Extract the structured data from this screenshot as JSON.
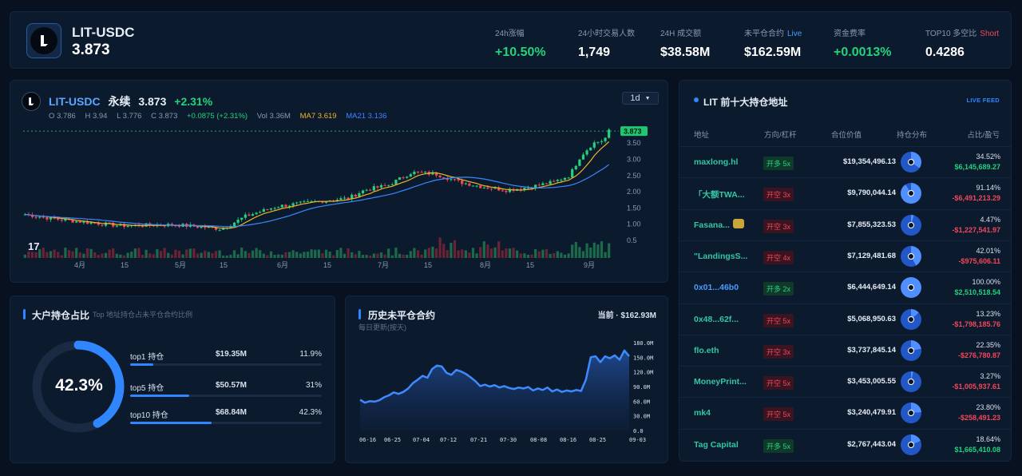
{
  "header": {
    "pair": "LIT-USDC",
    "price": "3.873",
    "stats": [
      {
        "label": "24h涨幅",
        "value": "+10.50%",
        "tone": "green",
        "tag": ""
      },
      {
        "label": "24小时交易人数",
        "value": "1,749",
        "tone": "white",
        "tag": ""
      },
      {
        "label": "24H 成交额",
        "value": "$38.58M",
        "tone": "white",
        "tag": ""
      },
      {
        "label": "未平仓合约",
        "value": "$162.59M",
        "tone": "white",
        "tag": "Live"
      },
      {
        "label": "资金费率",
        "value": "+0.0013%",
        "tone": "green",
        "tag": ""
      },
      {
        "label": "TOP10 多空比",
        "value": "0.4286",
        "tone": "white",
        "tag": "Short"
      }
    ]
  },
  "price_chart": {
    "pair": "LIT-USDC",
    "market": "永续",
    "last": "3.873",
    "change": "+2.31%",
    "interval": "1d",
    "ohlc": {
      "o": "O 3.786",
      "h": "H 3.94",
      "l": "L 3.776",
      "c": "C 3.873",
      "chg": "+0.0875 (+2.31%)",
      "vol": "Vol 3.36M"
    },
    "ma7": "MA7 3.619",
    "ma21": "MA21 3.136",
    "price_tag": "3.873",
    "y_ticks": [
      "3.50",
      "3.00",
      "2.50",
      "2.00",
      "1.50",
      "1.00",
      "0.5"
    ],
    "x_ticks": [
      "4月",
      "15",
      "5月",
      "15",
      "6月",
      "15",
      "7月",
      "15",
      "8月",
      "15",
      "9月"
    ],
    "colors": {
      "up": "#26d07c",
      "down": "#f2475a",
      "ma7": "#f0b429",
      "ma21": "#3a86ff"
    }
  },
  "chart_data": {
    "type": "line",
    "title": "历史未平仓合约",
    "subtitle": "每日更新(按天)",
    "current": "当前 · $162.93M",
    "x_ticks": [
      "06-16",
      "06-25",
      "07-04",
      "07-12",
      "07-21",
      "07-30",
      "08-08",
      "08-16",
      "08-25",
      "09-03"
    ],
    "y_ticks": [
      "180.0M",
      "150.0M",
      "120.0M",
      "90.0M",
      "60.0M",
      "30.0M",
      "0.0"
    ],
    "ylim": [
      0,
      180
    ],
    "series": [
      {
        "values": [
          63,
          57,
          60,
          59,
          62,
          68,
          72,
          78,
          75,
          79,
          86,
          97,
          104,
          112,
          108,
          126,
          133,
          131,
          118,
          114,
          124,
          121,
          116,
          109,
          101,
          91,
          94,
          90,
          93,
          88,
          91,
          87,
          85,
          88,
          86,
          89,
          82,
          86,
          83,
          88,
          80,
          84,
          79,
          82,
          80,
          83,
          81,
          104,
          150,
          152,
          140,
          152,
          148,
          154,
          145,
          164,
          152
        ]
      }
    ]
  },
  "concentration": {
    "title": "大户持仓占比",
    "subtitle": "Top 地址持仓占未平仓合约比例",
    "percent": "42.3%",
    "fraction": 0.423,
    "rows": [
      {
        "label": "top1 持仓",
        "value": "$19.35M",
        "pct": "11.9%",
        "fraction": 0.119
      },
      {
        "label": "top5 持仓",
        "value": "$50.57M",
        "pct": "31%",
        "fraction": 0.31
      },
      {
        "label": "top10 持仓",
        "value": "$68.84M",
        "pct": "42.3%",
        "fraction": 0.423
      }
    ]
  },
  "holders": {
    "title": "LIT 前十大持仓地址",
    "live": "LIVE FEED",
    "headers": [
      "地址",
      "方向/杠杆",
      "合位价值",
      "持仓分布",
      "占比/盈亏"
    ],
    "rows": [
      {
        "addr": "maxlong.hl",
        "side": "开多 5x",
        "dir": "long",
        "value": "$19,354,496.13",
        "share": "34.52%",
        "pnl": "$6,145,689.27",
        "pnl_tone": "green",
        "addr_tone": "teal"
      },
      {
        "addr": "「大额TWA...",
        "side": "开空 3x",
        "dir": "short",
        "value": "$9,790,044.14",
        "share": "91.14%",
        "pnl": "-$6,491,213.29",
        "pnl_tone": "red",
        "addr_tone": "teal"
      },
      {
        "addr": "Fasana...",
        "side": "开空 3x",
        "dir": "short",
        "value": "$7,855,323.53",
        "share": "4.47%",
        "pnl": "-$1,227,541.97",
        "pnl_tone": "red",
        "addr_tone": "teal"
      },
      {
        "addr": "\"LandingsS...",
        "side": "开空 4x",
        "dir": "short",
        "value": "$7,129,481.68",
        "share": "42.01%",
        "pnl": "-$975,606.11",
        "pnl_tone": "red",
        "addr_tone": "teal"
      },
      {
        "addr": "0x01...46b0",
        "side": "开多 2x",
        "dir": "long",
        "value": "$6,444,649.14",
        "share": "100.00%",
        "pnl": "$2,510,518.54",
        "pnl_tone": "green",
        "addr_tone": "blue"
      },
      {
        "addr": "0x48...62f...",
        "side": "开空 5x",
        "dir": "short",
        "value": "$5,068,950.63",
        "share": "13.23%",
        "pnl": "-$1,798,185.76",
        "pnl_tone": "red",
        "addr_tone": "teal"
      },
      {
        "addr": "flo.eth",
        "side": "开空 3x",
        "dir": "short",
        "value": "$3,737,845.14",
        "share": "22.35%",
        "pnl": "-$276,780.87",
        "pnl_tone": "red",
        "addr_tone": "teal"
      },
      {
        "addr": "MoneyPrint...",
        "side": "开空 5x",
        "dir": "short",
        "value": "$3,453,005.55",
        "share": "3.27%",
        "pnl": "-$1,005,937.61",
        "pnl_tone": "red",
        "addr_tone": "teal"
      },
      {
        "addr": "mk4",
        "side": "开空 5x",
        "dir": "short",
        "value": "$3,240,479.91",
        "share": "23.80%",
        "pnl": "-$258,491.23",
        "pnl_tone": "red",
        "addr_tone": "teal"
      },
      {
        "addr": "Tag Capital",
        "side": "开多 5x",
        "dir": "long",
        "value": "$2,767,443.04",
        "share": "18.64%",
        "pnl": "$1,665,410.08",
        "pnl_tone": "green",
        "addr_tone": "teal"
      }
    ]
  }
}
